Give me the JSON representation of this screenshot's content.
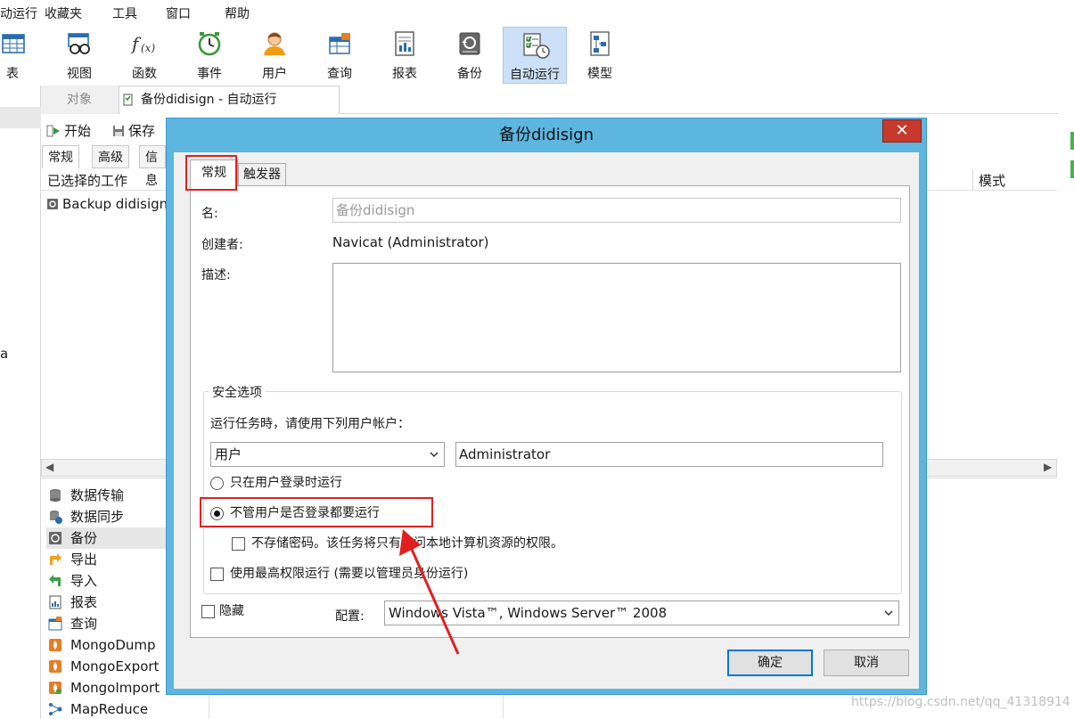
{
  "menu": [
    "动运行",
    "收藏夹",
    "工具",
    "窗口",
    "帮助"
  ],
  "toolbar": [
    {
      "label": "表",
      "icon": "table-icon"
    },
    {
      "label": "视图",
      "icon": "view-icon"
    },
    {
      "label": "函数",
      "icon": "function-icon"
    },
    {
      "label": "事件",
      "icon": "event-clock-icon"
    },
    {
      "label": "用户",
      "icon": "user-icon"
    },
    {
      "label": "查询",
      "icon": "query-icon"
    },
    {
      "label": "报表",
      "icon": "report-icon"
    },
    {
      "label": "备份",
      "icon": "backup-icon"
    },
    {
      "label": "自动运行",
      "icon": "automation-icon"
    },
    {
      "label": "模型",
      "icon": "model-icon"
    }
  ],
  "tabs": {
    "objects": "对象",
    "current": "备份didisign - 自动运行"
  },
  "bg": {
    "start": "开始",
    "save": "保存",
    "tab_general": "常规",
    "tab_advanced": "高级",
    "tab_info": "信息",
    "selected_jobs": "已选择的工作",
    "mode": "模式",
    "job_item": "Backup didisign",
    "left_char": "a"
  },
  "lower_list": [
    "数据传输",
    "数据同步",
    "备份",
    "导出",
    "导入",
    "报表",
    "查询",
    "MongoDump",
    "MongoExport",
    "MongoImport",
    "MapReduce"
  ],
  "dialog": {
    "title": "备份didisign",
    "close": "✕",
    "tab_general": "常规",
    "tab_trigger": "触发器",
    "name_label": "名:",
    "name_value": "备份didisign",
    "creator_label": "创建者:",
    "creator_value": "Navicat (Administrator)",
    "desc_label": "描述:",
    "desc_value": "",
    "security_group": "安全选项",
    "run_as_text": "运行任务時，请使用下列用户帐户：",
    "account_type": "用户",
    "account_name": "Administrator",
    "radio_logged_on": "只在用户登录时运行",
    "radio_whether": "不管用户是否登录都要运行",
    "no_store_pwd": "不存储密码。该任务将只有访问本地计算机资源的权限。",
    "highest_priv": "使用最高权限运行 (需要以管理员身份运行)",
    "hidden": "隐藏",
    "config_label": "配置:",
    "config_value": "Windows Vista™, Windows Server™ 2008",
    "ok": "确定",
    "cancel": "取消"
  },
  "watermark": "https://blog.csdn.net/qq_41318914",
  "colors": {
    "highlight": "#e0201f",
    "dialog_frame": "#5cb6e0",
    "close": "#c7392d",
    "toolbar_active": "#cce0f7"
  }
}
